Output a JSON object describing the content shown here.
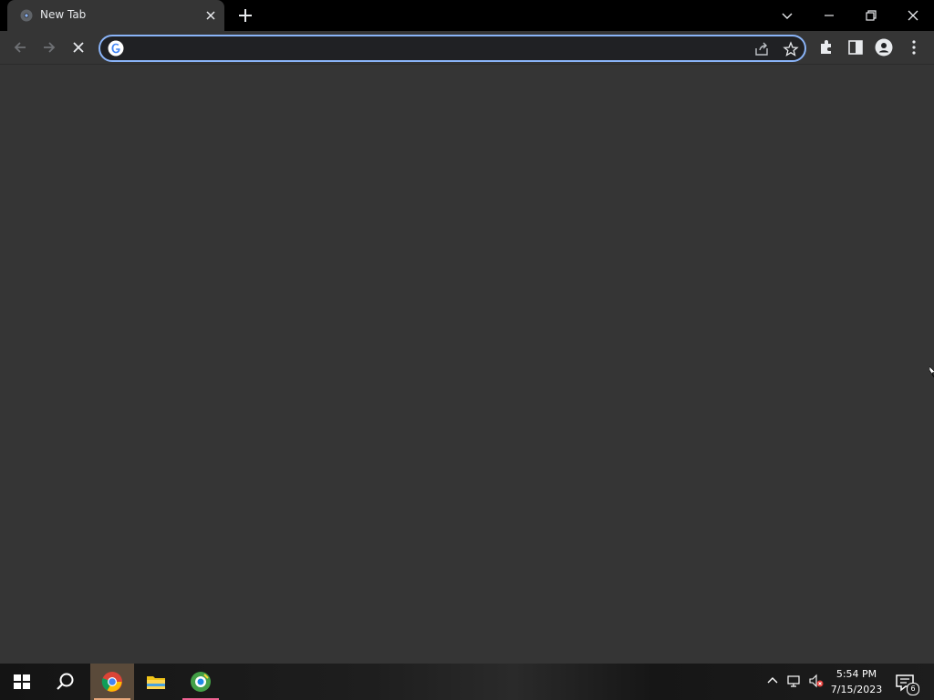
{
  "browser": {
    "tab": {
      "title": "New Tab"
    },
    "address_bar": {
      "value": "",
      "placeholder": ""
    },
    "accent_color": "#8ab4f8",
    "icons": [
      "chrome-favicon",
      "close-icon",
      "plus-icon",
      "chevron-down-icon",
      "minimize-icon",
      "restore-icon",
      "window-close-icon",
      "back-arrow-icon",
      "forward-arrow-icon",
      "stop-loading-icon",
      "google-g-icon",
      "share-icon",
      "star-icon",
      "extensions-icon",
      "side-panel-icon",
      "profile-icon",
      "kebab-menu-icon"
    ]
  },
  "taskbar": {
    "apps": [
      "windows-start",
      "search",
      "chrome",
      "file-explorer",
      "greenshot"
    ],
    "clock": {
      "time": "5:54 PM",
      "date": "7/15/2023"
    },
    "notifications": {
      "count": "6"
    },
    "tray_icons": [
      "chevron-up-icon",
      "network-icon",
      "volume-muted-icon"
    ]
  }
}
